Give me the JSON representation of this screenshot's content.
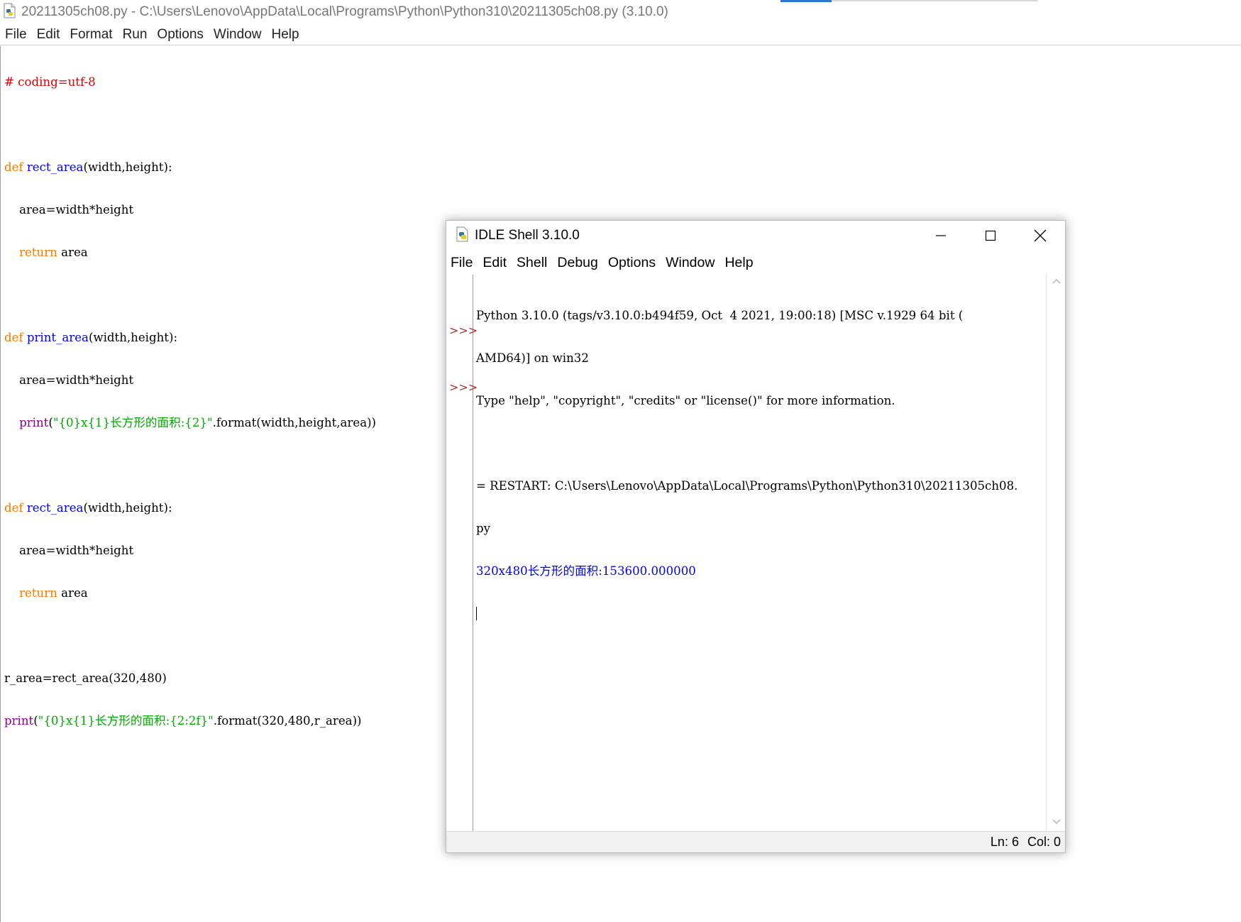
{
  "editor": {
    "title": "20211305ch08.py - C:\\Users\\Lenovo\\AppData\\Local\\Programs\\Python\\Python310\\20211305ch08.py (3.10.0)",
    "menu": [
      "File",
      "Edit",
      "Format",
      "Run",
      "Options",
      "Window",
      "Help"
    ],
    "code": {
      "l01": "# coding=utf-8",
      "l03_kw": "def",
      "l03_fn": "rect_area",
      "l03_rest": "(width,height):",
      "l04": "    area=width*height",
      "l05_kw": "return",
      "l05_rest": " area",
      "l07_kw": "def",
      "l07_fn": "print_area",
      "l07_rest": "(width,height):",
      "l08": "    area=width*height",
      "l09_bi": "print",
      "l09_p": "(",
      "l09_str": "\"{0}x{1}长方形的面积:{2}\"",
      "l09_rest": ".format(width,height,area))",
      "l11_kw": "def",
      "l11_fn": "rect_area",
      "l11_rest": "(width,height):",
      "l12": "    area=width*height",
      "l13_kw": "return",
      "l13_rest": " area",
      "l15": "r_area=rect_area(320,480)",
      "l16_bi": "print",
      "l16_p": "(",
      "l16_str": "\"{0}x{1}长方形的面积:{2:2f}\"",
      "l16_rest": ".format(320,480,r_area))"
    }
  },
  "shell": {
    "title": "IDLE Shell 3.10.0",
    "menu": [
      "File",
      "Edit",
      "Shell",
      "Debug",
      "Options",
      "Window",
      "Help"
    ],
    "prompt": ">>>",
    "lines": [
      "Python 3.10.0 (tags/v3.10.0:b494f59, Oct  4 2021, 19:00:18) [MSC v.1929 64 bit (",
      "AMD64)] on win32",
      "Type \"help\", \"copyright\", \"credits\" or \"license()\" for more information.",
      "",
      "= RESTART: C:\\Users\\Lenovo\\AppData\\Local\\Programs\\Python\\Python310\\20211305ch08.",
      "py",
      "320x480长方形的面积:153600.000000"
    ],
    "status": {
      "ln": "Ln: 6",
      "col": "Col: 0"
    }
  },
  "colors": {
    "keyword": "#ff7700",
    "function_name": "#0000ff",
    "builtin": "#900090",
    "string": "#00aa00",
    "comment": "#dd0000",
    "shell_output": "#0000ff",
    "prompt": "#a52a2a"
  },
  "icons": {
    "editor": "python-file-icon",
    "shell": "python-icon",
    "window_buttons": [
      "minimize-icon",
      "maximize-icon",
      "close-icon"
    ],
    "scroll": [
      "scroll-up-icon",
      "scroll-down-icon"
    ]
  }
}
